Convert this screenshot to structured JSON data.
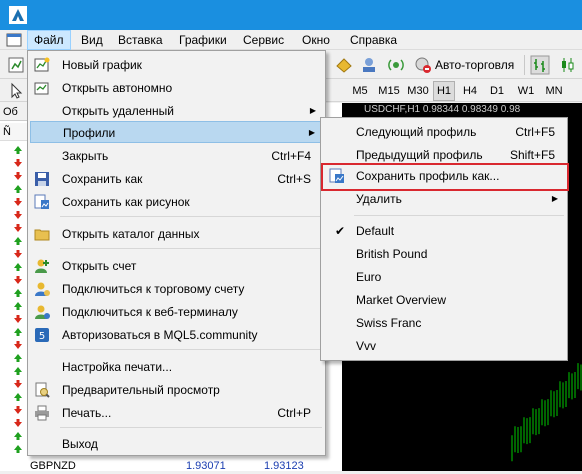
{
  "menubar": {
    "items": [
      "Файл",
      "Вид",
      "Вставка",
      "Графики",
      "Сервис",
      "Окно",
      "Справка"
    ]
  },
  "toolbar": {
    "autotrade_label": "Авто-торговля"
  },
  "timeframes": [
    "M5",
    "M15",
    "M30",
    "H1",
    "H4",
    "D1",
    "W1",
    "MN"
  ],
  "active_timeframe": "H1",
  "market_watch": {
    "header": "Об",
    "column": "Ñ",
    "last_row": {
      "symbol": "GBPNZD",
      "bid": "1.93071",
      "ask": "1.93123"
    }
  },
  "chart": {
    "title": "USDCHF,H1  0.98344 0.98349 0.98"
  },
  "file_menu": {
    "items": [
      {
        "label": "Новый график",
        "shortcut": "",
        "icon": "new-chart-icon"
      },
      {
        "label": "Открыть автономно",
        "shortcut": "",
        "icon": "open-offline-icon"
      },
      {
        "label": "Открыть удаленный",
        "shortcut": "",
        "icon": ""
      },
      {
        "label": "Профили",
        "shortcut": "",
        "icon": ""
      },
      {
        "label": "Закрыть",
        "shortcut": "Ctrl+F4",
        "icon": ""
      },
      {
        "label": "Сохранить как",
        "shortcut": "Ctrl+S",
        "icon": "save-icon"
      },
      {
        "label": "Сохранить как рисунок",
        "shortcut": "",
        "icon": "save-picture-icon"
      },
      {
        "label": "Открыть каталог данных",
        "shortcut": "",
        "icon": "folder-icon"
      },
      {
        "label": "Открыть счет",
        "shortcut": "",
        "icon": "open-account-icon"
      },
      {
        "label": "Подключиться к торговому счету",
        "shortcut": "",
        "icon": "login-account-icon"
      },
      {
        "label": "Подключиться к веб-терминалу",
        "shortcut": "",
        "icon": "web-terminal-icon"
      },
      {
        "label": "Авторизоваться в MQL5.community",
        "shortcut": "",
        "icon": "mql5-icon"
      },
      {
        "label": "Настройка печати...",
        "shortcut": "",
        "icon": ""
      },
      {
        "label": "Предварительный просмотр",
        "shortcut": "",
        "icon": "print-preview-icon"
      },
      {
        "label": "Печать...",
        "shortcut": "Ctrl+P",
        "icon": "print-icon"
      },
      {
        "label": "Выход",
        "shortcut": "",
        "icon": ""
      }
    ]
  },
  "profiles_menu": {
    "items": [
      {
        "label": "Следующий профиль",
        "shortcut": "Ctrl+F5"
      },
      {
        "label": "Предыдущий профиль",
        "shortcut": "Shift+F5"
      },
      {
        "label": "Сохранить профиль как...",
        "shortcut": ""
      },
      {
        "label": "Удалить",
        "shortcut": ""
      },
      {
        "label": "Default",
        "shortcut": "",
        "checked": true
      },
      {
        "label": "British Pound",
        "shortcut": ""
      },
      {
        "label": "Euro",
        "shortcut": ""
      },
      {
        "label": "Market Overview",
        "shortcut": ""
      },
      {
        "label": "Swiss Franc",
        "shortcut": ""
      },
      {
        "label": "Vvv",
        "shortcut": ""
      }
    ]
  },
  "colors": {
    "titlebar": "#1a8fe0",
    "highlight": "#b9d8f0",
    "annotation_red": "#d9282f",
    "chart_bg": "#000000",
    "candle_green": "#00c800"
  }
}
